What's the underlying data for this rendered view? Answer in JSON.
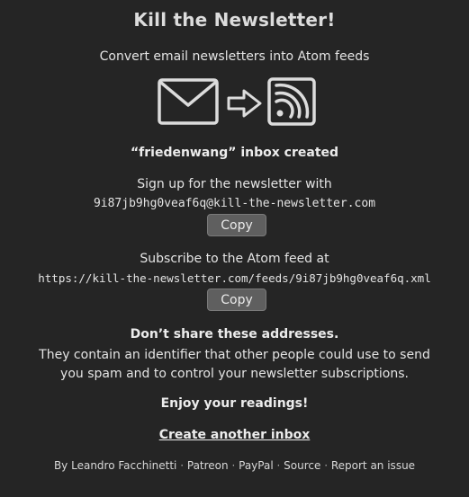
{
  "page": {
    "title": "Kill the Newsletter!",
    "subtitle": "Convert email newsletters into Atom feeds"
  },
  "logo": {
    "icons": [
      "envelope-icon",
      "arrow-right-icon",
      "rss-feed-icon"
    ],
    "stroke_color": "#dcdcdc"
  },
  "inbox": {
    "created_message": "“friedenwang” inbox created",
    "signup_text": "Sign up for the newsletter with",
    "email": "9i87jb9hg0veaf6q@kill-the-newsletter.com",
    "copy_label": "Copy",
    "subscribe_text": "Subscribe to the Atom feed at",
    "feed_url": "https://kill-the-newsletter.com/feeds/9i87jb9hg0veaf6q.xml"
  },
  "warning": {
    "title": "Don’t share these addresses.",
    "text": "They contain an identifier that other people could use to send you spam and to control your newsletter subscriptions."
  },
  "enjoy": "Enjoy your readings!",
  "create_another": "Create another inbox",
  "footer": {
    "by": "By",
    "author": "Leandro Facchinetti",
    "separator": "·",
    "links": [
      "Patreon",
      "PayPal",
      "Source",
      "Report an issue"
    ]
  },
  "colors": {
    "background": "#252525",
    "text": "#e4e4e4",
    "button_bg": "#5f5f5f",
    "button_border": "#7a7a7a"
  }
}
